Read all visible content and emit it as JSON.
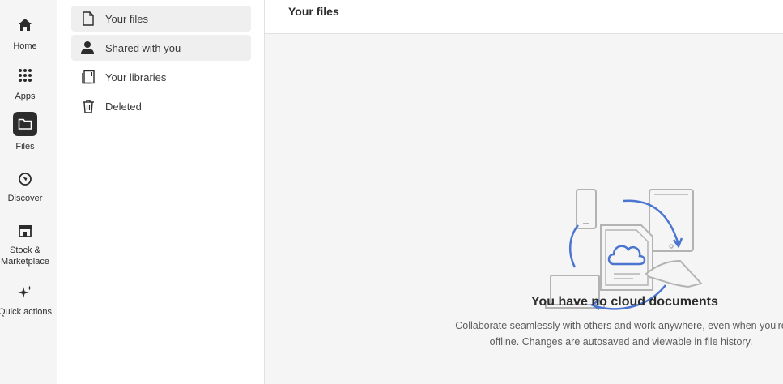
{
  "rail": {
    "items": [
      {
        "label": "Home",
        "icon": "home-icon"
      },
      {
        "label": "Apps",
        "icon": "apps-grid-icon"
      },
      {
        "label": "Files",
        "icon": "folder-icon"
      },
      {
        "label": "Discover",
        "icon": "compass-icon"
      },
      {
        "label": "Stock &\nMarketplace",
        "icon": "storefront-icon"
      },
      {
        "label": "Quick actions",
        "icon": "sparkle-icon"
      }
    ]
  },
  "subnav": {
    "items": [
      {
        "label": "Your files",
        "icon": "document-icon"
      },
      {
        "label": "Shared with you",
        "icon": "user-icon"
      },
      {
        "label": "Your libraries",
        "icon": "library-icon"
      },
      {
        "label": "Deleted",
        "icon": "trash-icon"
      }
    ]
  },
  "header": {
    "title": "Your files"
  },
  "empty_state": {
    "title": "You have no cloud documents",
    "description": "Collaborate seamlessly with others and work anywhere, even when you're offline. Changes are autosaved and viewable in file history."
  },
  "colors": {
    "accent": "#4b75d0",
    "illustration_gray": "#b3b3b3",
    "selected_bg": "#efefef"
  }
}
